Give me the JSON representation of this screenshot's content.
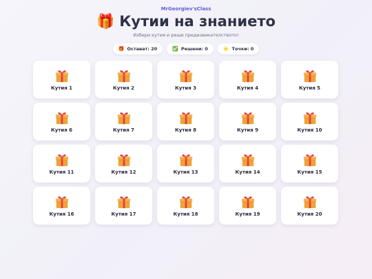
{
  "header": {
    "brand": "MrGeorgiev'sClass",
    "title_icon": "🎁",
    "title": "Кутии на знанието",
    "subtitle": "Избери кутия и реши предизвикателството!"
  },
  "stats": [
    {
      "icon": "🎁",
      "label": "Остават: 20"
    },
    {
      "icon": "✅",
      "label": "Решени: 0"
    },
    {
      "icon": "⭐",
      "label": "Точки: 0"
    }
  ],
  "boxes": [
    {
      "label": "Кутия 1"
    },
    {
      "label": "Кутия 2"
    },
    {
      "label": "Кутия 3"
    },
    {
      "label": "Кутия 4"
    },
    {
      "label": "Кутия 5"
    },
    {
      "label": "Кутия 6"
    },
    {
      "label": "Кутия 7"
    },
    {
      "label": "Кутия 8"
    },
    {
      "label": "Кутия 9"
    },
    {
      "label": "Кутия 10"
    },
    {
      "label": "Кутия 11"
    },
    {
      "label": "Кутия 12"
    },
    {
      "label": "Кутия 13"
    },
    {
      "label": "Кутия 14"
    },
    {
      "label": "Кутия 15"
    },
    {
      "label": "Кутия 16"
    },
    {
      "label": "Кутия 17"
    },
    {
      "label": "Кутия 18"
    },
    {
      "label": "Кутия 19"
    },
    {
      "label": "Кутия 20"
    }
  ],
  "box_icon": "gift-icon",
  "colors": {
    "accent": "#5b5fd6",
    "gift_box": "#f0a23a",
    "gift_ribbon": "#e23c3c"
  }
}
